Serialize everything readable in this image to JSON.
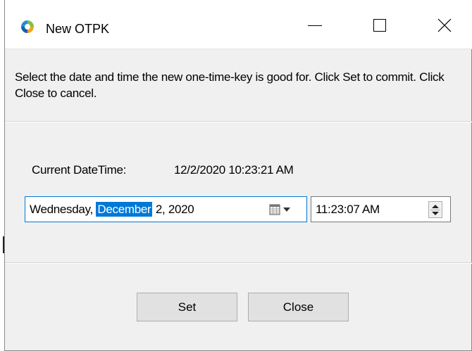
{
  "window": {
    "title": "New OTPK",
    "app_icon": "otpk-app-icon",
    "controls": {
      "minimize_icon": "minimize-icon",
      "maximize_icon": "maximize-icon",
      "close_icon": "close-icon"
    }
  },
  "instructions": "Select the date and time the new one-time-key is good for. Click Set to commit. Click Close to cancel.",
  "current": {
    "label": "Current DateTime:",
    "value": "12/2/2020 10:23:21 AM"
  },
  "date_picker": {
    "weekday": "Wednesday, ",
    "month": "December",
    "rest": " 2, 2020",
    "calendar_icon": "calendar-icon",
    "dropdown_icon": "chevron-down-icon"
  },
  "time_picker": {
    "value": "11:23:07 AM",
    "spinner_icon": "spinner-icon"
  },
  "buttons": {
    "set": "Set",
    "close": "Close"
  },
  "colors": {
    "accent": "#0078d7",
    "dialog_bg": "#f0f0f0",
    "button_bg": "#e1e1e1"
  }
}
